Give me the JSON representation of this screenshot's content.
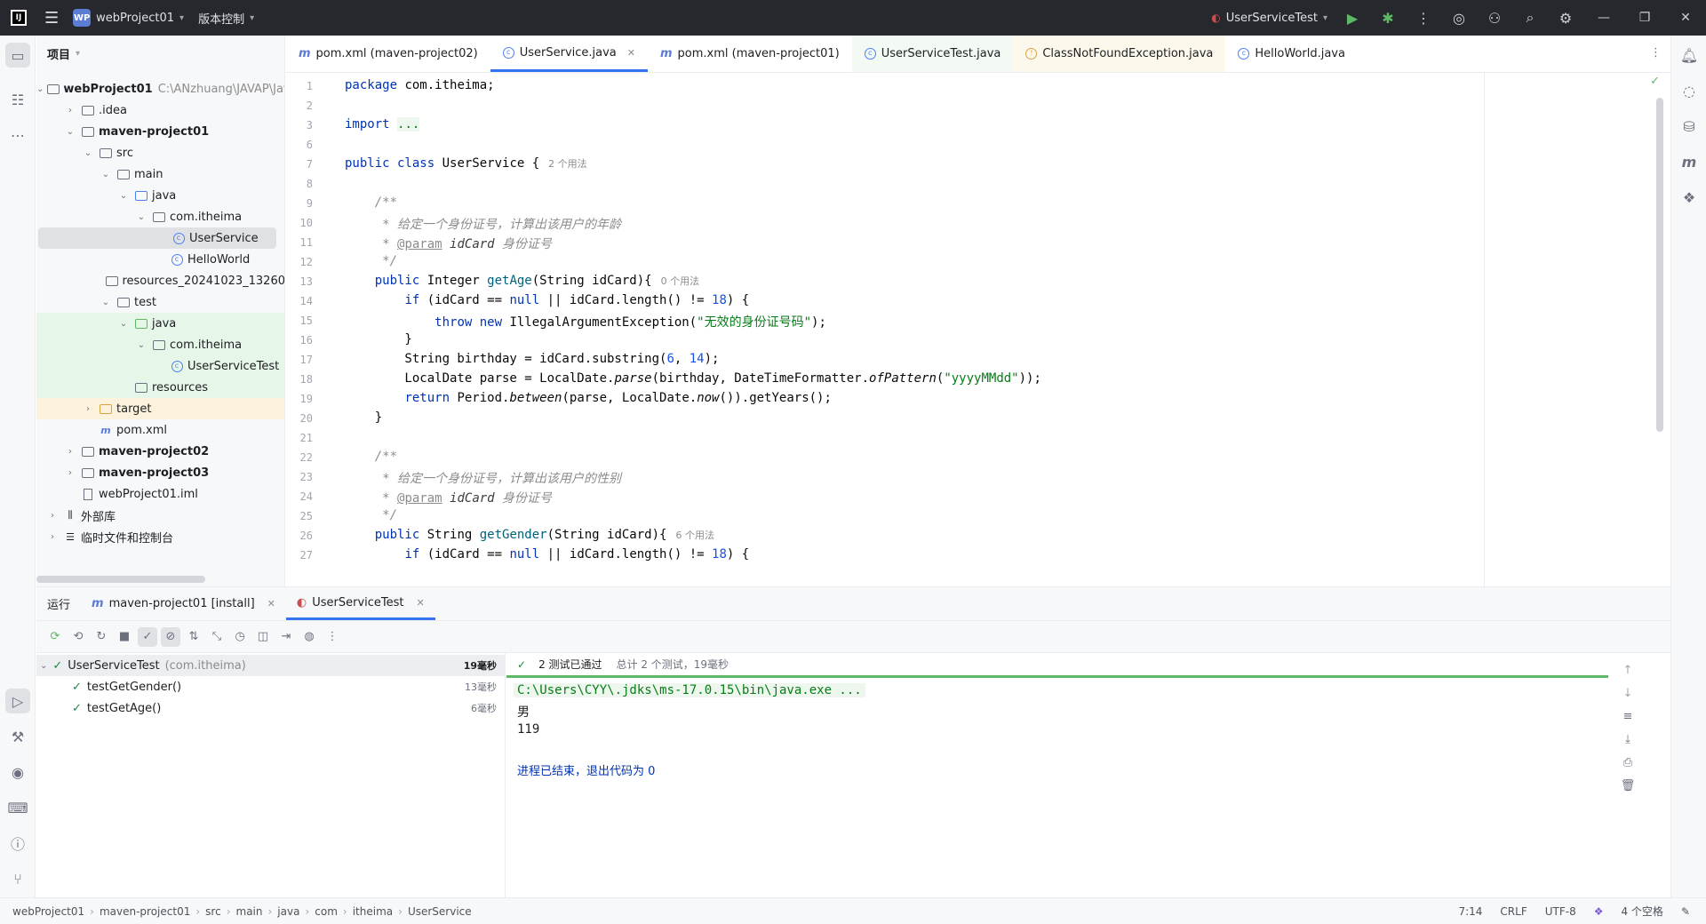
{
  "titlebar": {
    "project_badge": "WP",
    "project_name": "webProject01",
    "vcs_label": "版本控制",
    "run_config": "UserServiceTest"
  },
  "project_panel": {
    "title": "项目",
    "tree": [
      {
        "label": "webProject01",
        "extra": "C:\\ANzhuang\\JAVAP\\Jav",
        "depth": 0,
        "arrow": "open",
        "icon": "module-folder",
        "bold": true
      },
      {
        "label": ".idea",
        "depth": 1,
        "arrow": "closed",
        "icon": "folder"
      },
      {
        "label": "maven-project01",
        "depth": 1,
        "arrow": "open",
        "icon": "module-folder",
        "bold": true
      },
      {
        "label": "src",
        "depth": 2,
        "arrow": "open",
        "icon": "folder"
      },
      {
        "label": "main",
        "depth": 3,
        "arrow": "open",
        "icon": "folder"
      },
      {
        "label": "java",
        "depth": 4,
        "arrow": "open",
        "icon": "source-folder"
      },
      {
        "label": "com.itheima",
        "depth": 5,
        "arrow": "open",
        "icon": "package"
      },
      {
        "label": "UserService",
        "depth": 6,
        "arrow": "none",
        "icon": "class",
        "selected": true
      },
      {
        "label": "HelloWorld",
        "depth": 6,
        "arrow": "none",
        "icon": "class"
      },
      {
        "label": "resources_20241023_13260",
        "depth": 4,
        "arrow": "none",
        "icon": "folder"
      },
      {
        "label": "test",
        "depth": 3,
        "arrow": "open",
        "icon": "folder"
      },
      {
        "label": "java",
        "depth": 4,
        "arrow": "open",
        "icon": "test-folder",
        "highlight": "green"
      },
      {
        "label": "com.itheima",
        "depth": 5,
        "arrow": "open",
        "icon": "package",
        "highlight": "green"
      },
      {
        "label": "UserServiceTest",
        "depth": 6,
        "arrow": "none",
        "icon": "class",
        "highlight": "green"
      },
      {
        "label": "resources",
        "depth": 4,
        "arrow": "none",
        "icon": "folder",
        "highlight": "green"
      },
      {
        "label": "target",
        "depth": 2,
        "arrow": "closed",
        "icon": "folder",
        "highlight": "yellow"
      },
      {
        "label": "pom.xml",
        "depth": 2,
        "arrow": "none",
        "icon": "maven"
      },
      {
        "label": "maven-project02",
        "depth": 1,
        "arrow": "closed",
        "icon": "module-folder",
        "bold": true
      },
      {
        "label": "maven-project03",
        "depth": 1,
        "arrow": "closed",
        "icon": "module-folder",
        "bold": true
      },
      {
        "label": "webProject01.iml",
        "depth": 1,
        "arrow": "none",
        "icon": "file"
      },
      {
        "label": "外部库",
        "depth": 0,
        "arrow": "closed",
        "icon": "library"
      },
      {
        "label": "临时文件和控制台",
        "depth": 0,
        "arrow": "closed",
        "icon": "scratch"
      }
    ]
  },
  "tabs": [
    {
      "label": "pom.xml (maven-project02)",
      "icon": "m",
      "active": false
    },
    {
      "label": "UserService.java",
      "icon": "class",
      "active": true,
      "closable": true
    },
    {
      "label": "pom.xml (maven-project01)",
      "icon": "m",
      "active": false
    },
    {
      "label": "UserServiceTest.java",
      "icon": "class",
      "active": false,
      "tint": "green"
    },
    {
      "label": "ClassNotFoundException.java",
      "icon": "exception",
      "active": false,
      "tint": "yellow"
    },
    {
      "label": "HelloWorld.java",
      "icon": "class",
      "active": false
    }
  ],
  "editor": {
    "lines": [
      {
        "n": "1",
        "code": "<span class=\"kw\">package</span> com.itheima;"
      },
      {
        "n": "2",
        "code": ""
      },
      {
        "n": "3",
        "code": "<span class=\"kw\">import</span> <span class=\"str\" style=\"background:#edf7ed\">...</span>"
      },
      {
        "n": "6",
        "code": ""
      },
      {
        "n": "7",
        "code": "<span class=\"kw\">public class</span> UserService {",
        "hint": "2 个用法"
      },
      {
        "n": "8",
        "code": ""
      },
      {
        "n": "9",
        "code": "    <span class=\"cm\">/**</span>"
      },
      {
        "n": "10",
        "code": "     <span class=\"cm\">* 给定一个身份证号，计算出该用户的年龄</span>"
      },
      {
        "n": "11",
        "code": "     <span class=\"cm\">* </span><span class=\"tag\">@param</span> <span class=\"param\">idCard</span> <span class=\"cm\">身份证号</span>"
      },
      {
        "n": "12",
        "code": "     <span class=\"cm\">*/</span>"
      },
      {
        "n": "13",
        "code": "    <span class=\"kw\">public</span> Integer <span class=\"fn\">getAge</span>(String idCard){",
        "hint": "0 个用法"
      },
      {
        "n": "14",
        "code": "        <span class=\"kw\">if</span> (idCard == <span class=\"kw\">null</span> || idCard.length() != <span class=\"num\">18</span>) {"
      },
      {
        "n": "15",
        "code": "            <span class=\"kw\">throw new</span> IllegalArgumentException(<span class=\"str\">\"无效的身份证号码\"</span>);"
      },
      {
        "n": "16",
        "code": "        }"
      },
      {
        "n": "17",
        "code": "        String birthday = idCard.substring(<span class=\"num\">6</span>, <span class=\"num\">14</span>);"
      },
      {
        "n": "18",
        "code": "        LocalDate parse = LocalDate.<span class=\"it\">parse</span>(birthday, DateTimeFormatter.<span class=\"it\">ofPattern</span>(<span class=\"str\">\"yyyyMMdd\"</span>));"
      },
      {
        "n": "19",
        "code": "        <span class=\"kw\">return</span> Period.<span class=\"it\">between</span>(parse, LocalDate.<span class=\"it\">now</span>()).getYears();"
      },
      {
        "n": "20",
        "code": "    }"
      },
      {
        "n": "21",
        "code": ""
      },
      {
        "n": "22",
        "code": "    <span class=\"cm\">/**</span>"
      },
      {
        "n": "23",
        "code": "     <span class=\"cm\">* 给定一个身份证号，计算出该用户的性别</span>"
      },
      {
        "n": "24",
        "code": "     <span class=\"cm\">* </span><span class=\"tag\">@param</span> <span class=\"param\">idCard</span> <span class=\"cm\">身份证号</span>"
      },
      {
        "n": "25",
        "code": "     <span class=\"cm\">*/</span>"
      },
      {
        "n": "26",
        "code": "    <span class=\"kw\">public</span> String <span class=\"fn\">getGender</span>(String idCard){",
        "hint": "6 个用法"
      },
      {
        "n": "27",
        "code": "        <span class=\"kw\">if</span> (idCard == <span class=\"kw\">null</span> || idCard.length() != <span class=\"num\">18</span>) {"
      }
    ]
  },
  "run_panel": {
    "title": "运行",
    "tabs": [
      {
        "label": "maven-project01 [install]",
        "icon": "m",
        "active": false
      },
      {
        "label": "UserServiceTest",
        "icon": "test",
        "active": true
      }
    ],
    "tests": [
      {
        "label": "UserServiceTest",
        "pkg": "(com.itheima)",
        "time": "19毫秒",
        "depth": 0
      },
      {
        "label": "testGetGender()",
        "time": "13毫秒",
        "depth": 1
      },
      {
        "label": "testGetAge()",
        "time": "6毫秒",
        "depth": 1
      }
    ],
    "result_summary": "2 测试已通过",
    "result_detail": "总计 2 个测试，19毫秒",
    "console": [
      {
        "text": "C:\\Users\\CYY\\.jdks\\ms-17.0.15\\bin\\java.exe ...",
        "style": "cmd"
      },
      {
        "text": "男",
        "style": "out"
      },
      {
        "text": "119",
        "style": "out"
      },
      {
        "text": "",
        "style": "out"
      },
      {
        "text": "进程已结束，退出代码为 0",
        "style": "exit"
      }
    ]
  },
  "statusbar": {
    "breadcrumbs": [
      "webProject01",
      "maven-project01",
      "src",
      "main",
      "java",
      "com",
      "itheima",
      "UserService"
    ],
    "position": "7:14",
    "line_sep": "CRLF",
    "encoding": "UTF-8",
    "indent": "4 个空格"
  }
}
